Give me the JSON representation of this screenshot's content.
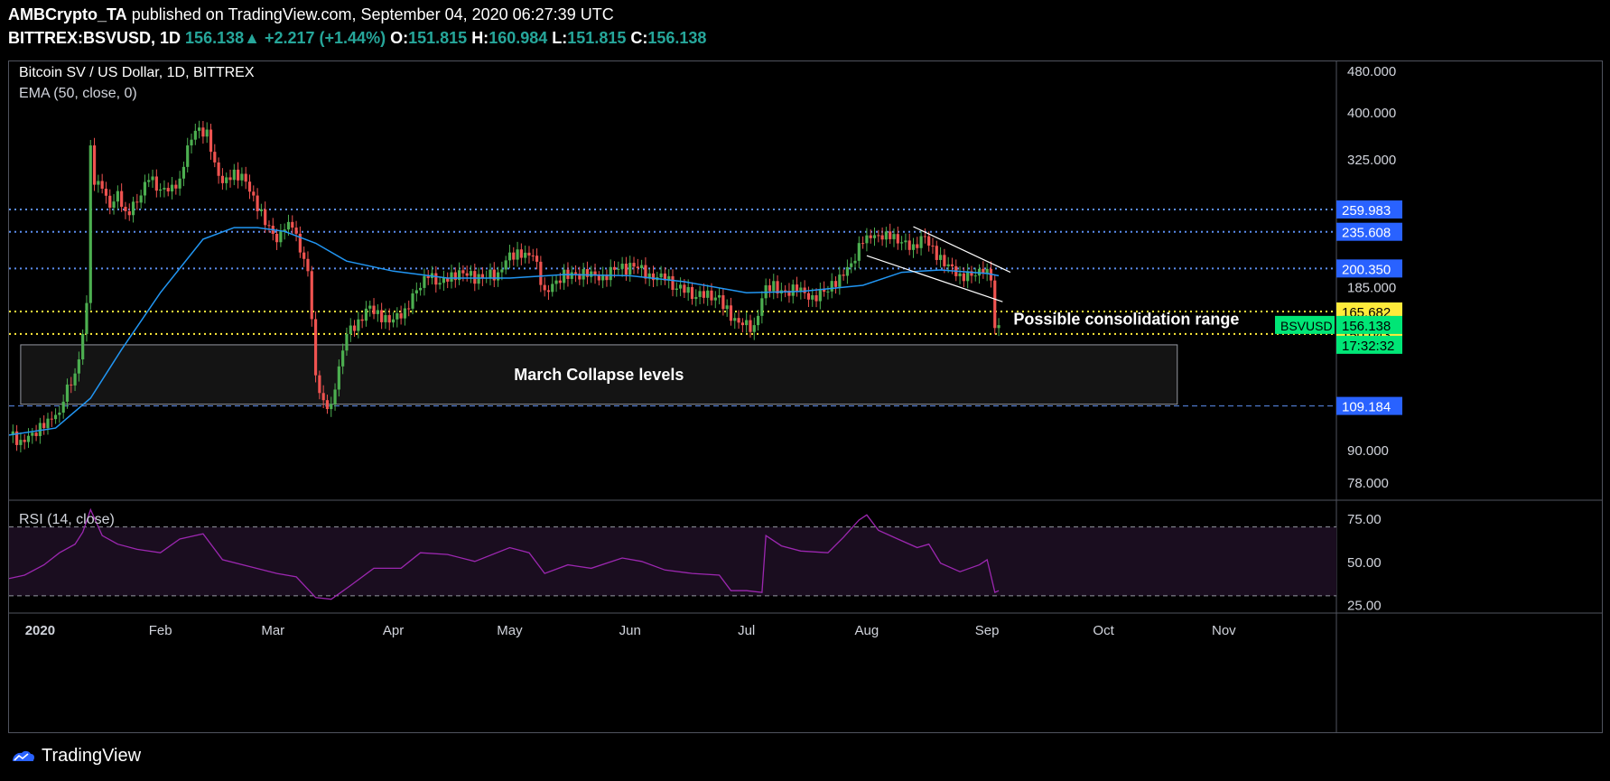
{
  "header": {
    "author": "AMBCrypto_TA",
    "published_text": "published on TradingView.com, September 04, 2020 06:27:39 UTC",
    "symbol": "BITTREX:BSVUSD, 1D",
    "last": "156.138",
    "up_arrow": "▲",
    "change": "+2.217 (+1.44%)",
    "o_label": "O:",
    "o_value": "151.815",
    "h_label": "H:",
    "h_value": "160.984",
    "l_label": "L:",
    "l_value": "151.815",
    "c_label": "C:",
    "c_value": "156.138"
  },
  "footer": {
    "brand": "TradingView",
    "icon": "tradingview-logo-icon"
  },
  "colors": {
    "up": "#26a69a",
    "bull_candle": "#4caf50",
    "bear_candle": "#ef5350",
    "ema": "#2196f3",
    "level_blue": "#5b8def",
    "level_yellow": "#ffeb3b",
    "rsi": "#9c27b0",
    "rsi_band": "#1a0d1f",
    "price_tag": "#00e676"
  },
  "chart_data": [
    {
      "type": "candlestick",
      "title": "Bitcoin SV / US Dollar, 1D, BITTREX",
      "indicator_label": "EMA (50, close, 0)",
      "y_scale": "log",
      "ylim": [
        72,
        500
      ],
      "y_ticks": [
        "480.000",
        "400.000",
        "325.000",
        "235.608",
        "185.000",
        "90.000",
        "78.000"
      ],
      "x_ticks": [
        "2020",
        "Feb",
        "Mar",
        "Apr",
        "May",
        "Jun",
        "Jul",
        "Aug",
        "Sep",
        "Oct",
        "Nov"
      ],
      "x_range": [
        "2019-12-24",
        "2020-11-30"
      ],
      "levels": [
        {
          "label": "259.983",
          "value": 259.983,
          "color": "#5b8def",
          "style": "dotted"
        },
        {
          "label": "235.608",
          "value": 235.608,
          "color": "#5b8def",
          "style": "dotted"
        },
        {
          "label": "200.350",
          "value": 200.35,
          "color": "#5b8def",
          "style": "dotted"
        },
        {
          "label": "165.682",
          "value": 165.682,
          "color": "#ffeb3b",
          "style": "dotted"
        },
        {
          "label": "150.043",
          "value": 150.043,
          "color": "#ffeb3b",
          "style": "dotted"
        },
        {
          "label": "109.184",
          "value": 109.184,
          "color": "#5b8def",
          "style": "dashed"
        }
      ],
      "current_price": {
        "label": "156.138",
        "value": 156.138,
        "countdown": "17:32:32",
        "symbol_tag": "BSVUSD"
      },
      "annotations": [
        {
          "text": "March Collapse levels",
          "x_from": "2019-12-27",
          "x_to": "2020-10-20",
          "y_low": 110,
          "y_high": 143
        },
        {
          "text": "Possible consolidation range",
          "x": "2020-09-05",
          "y": 160
        }
      ],
      "trendlines": [
        {
          "from": [
            "2020-08-13",
            241
          ],
          "to": [
            "2020-09-07",
            197
          ]
        },
        {
          "from": [
            "2020-08-01",
            212
          ],
          "to": [
            "2020-09-05",
            173
          ]
        }
      ],
      "series": [
        {
          "name": "BSVUSD",
          "points": [
            [
              "2019-12-24",
              96
            ],
            [
              "2019-12-27",
              94
            ],
            [
              "2019-12-30",
              97
            ],
            [
              "2020-01-02",
              99
            ],
            [
              "2020-01-04",
              103
            ],
            [
              "2020-01-06",
              106
            ],
            [
              "2020-01-08",
              120
            ],
            [
              "2020-01-10",
              126
            ],
            [
              "2020-01-12",
              150
            ],
            [
              "2020-01-13",
              172
            ],
            [
              "2020-01-14",
              345
            ],
            [
              "2020-01-15",
              290
            ],
            [
              "2020-01-17",
              285
            ],
            [
              "2020-01-19",
              262
            ],
            [
              "2020-01-21",
              282
            ],
            [
              "2020-01-23",
              258
            ],
            [
              "2020-01-26",
              268
            ],
            [
              "2020-01-29",
              296
            ],
            [
              "2020-02-01",
              284
            ],
            [
              "2020-02-04",
              290
            ],
            [
              "2020-02-06",
              298
            ],
            [
              "2020-02-08",
              345
            ],
            [
              "2020-02-10",
              368
            ],
            [
              "2020-02-13",
              370
            ],
            [
              "2020-02-15",
              320
            ],
            [
              "2020-02-17",
              292
            ],
            [
              "2020-02-20",
              310
            ],
            [
              "2020-02-23",
              294
            ],
            [
              "2020-02-26",
              258
            ],
            [
              "2020-02-29",
              242
            ],
            [
              "2020-03-02",
              225
            ],
            [
              "2020-03-04",
              238
            ],
            [
              "2020-03-06",
              240
            ],
            [
              "2020-03-08",
              215
            ],
            [
              "2020-03-10",
              198
            ],
            [
              "2020-03-12",
              125
            ],
            [
              "2020-03-14",
              112
            ],
            [
              "2020-03-16",
              110
            ],
            [
              "2020-03-18",
              130
            ],
            [
              "2020-03-20",
              150
            ],
            [
              "2020-03-23",
              160
            ],
            [
              "2020-03-26",
              170
            ],
            [
              "2020-03-29",
              158
            ],
            [
              "2020-04-01",
              160
            ],
            [
              "2020-04-04",
              168
            ],
            [
              "2020-04-07",
              182
            ],
            [
              "2020-04-10",
              192
            ],
            [
              "2020-04-13",
              188
            ],
            [
              "2020-04-16",
              197
            ],
            [
              "2020-04-20",
              194
            ],
            [
              "2020-04-24",
              192
            ],
            [
              "2020-04-28",
              197
            ],
            [
              "2020-05-01",
              215
            ],
            [
              "2020-05-04",
              210
            ],
            [
              "2020-05-07",
              212
            ],
            [
              "2020-05-10",
              182
            ],
            [
              "2020-05-13",
              190
            ],
            [
              "2020-05-17",
              197
            ],
            [
              "2020-05-21",
              193
            ],
            [
              "2020-05-25",
              195
            ],
            [
              "2020-05-29",
              200
            ],
            [
              "2020-06-02",
              202
            ],
            [
              "2020-06-06",
              196
            ],
            [
              "2020-06-10",
              190
            ],
            [
              "2020-06-15",
              180
            ],
            [
              "2020-06-20",
              176
            ],
            [
              "2020-06-24",
              178
            ],
            [
              "2020-06-27",
              159
            ],
            [
              "2020-06-30",
              156
            ],
            [
              "2020-07-03",
              156
            ],
            [
              "2020-07-06",
              186
            ],
            [
              "2020-07-10",
              182
            ],
            [
              "2020-07-14",
              181
            ],
            [
              "2020-07-18",
              178
            ],
            [
              "2020-07-22",
              181
            ],
            [
              "2020-07-25",
              195
            ],
            [
              "2020-07-28",
              205
            ],
            [
              "2020-07-31",
              224
            ],
            [
              "2020-08-02",
              229
            ],
            [
              "2020-08-04",
              232
            ],
            [
              "2020-08-07",
              228
            ],
            [
              "2020-08-10",
              225
            ],
            [
              "2020-08-13",
              223
            ],
            [
              "2020-08-16",
              231
            ],
            [
              "2020-08-19",
              208
            ],
            [
              "2020-08-22",
              204
            ],
            [
              "2020-08-25",
              196
            ],
            [
              "2020-08-28",
              194
            ],
            [
              "2020-08-31",
              196
            ],
            [
              "2020-09-01",
              200
            ],
            [
              "2020-09-02",
              190
            ],
            [
              "2020-09-03",
              154
            ],
            [
              "2020-09-04",
              156
            ]
          ]
        },
        {
          "name": "EMA (50, close, 0)",
          "points": [
            [
              "2019-12-24",
              96
            ],
            [
              "2020-01-05",
              99
            ],
            [
              "2020-01-14",
              113
            ],
            [
              "2020-01-22",
              140
            ],
            [
              "2020-02-01",
              180
            ],
            [
              "2020-02-12",
              228
            ],
            [
              "2020-02-20",
              240
            ],
            [
              "2020-02-26",
              240
            ],
            [
              "2020-03-04",
              236
            ],
            [
              "2020-03-12",
              224
            ],
            [
              "2020-03-20",
              207
            ],
            [
              "2020-04-01",
              198
            ],
            [
              "2020-04-15",
              192
            ],
            [
              "2020-05-01",
              192
            ],
            [
              "2020-05-15",
              195
            ],
            [
              "2020-06-01",
              194
            ],
            [
              "2020-06-15",
              189
            ],
            [
              "2020-07-01",
              180
            ],
            [
              "2020-07-15",
              181
            ],
            [
              "2020-07-31",
              186
            ],
            [
              "2020-08-10",
              197
            ],
            [
              "2020-08-20",
              199
            ],
            [
              "2020-09-01",
              196
            ],
            [
              "2020-09-04",
              194
            ]
          ]
        }
      ]
    },
    {
      "type": "line",
      "title": "RSI (14, close)",
      "ylim": [
        20,
        85
      ],
      "y_ticks": [
        "75.00",
        "50.00",
        "25.00"
      ],
      "bands": [
        30,
        70
      ],
      "series": [
        {
          "name": "RSI",
          "points": [
            [
              "2019-12-24",
              40
            ],
            [
              "2019-12-28",
              42
            ],
            [
              "2020-01-02",
              48
            ],
            [
              "2020-01-06",
              55
            ],
            [
              "2020-01-10",
              60
            ],
            [
              "2020-01-12",
              67
            ],
            [
              "2020-01-14",
              80
            ],
            [
              "2020-01-17",
              65
            ],
            [
              "2020-01-21",
              60
            ],
            [
              "2020-01-26",
              57
            ],
            [
              "2020-02-01",
              55
            ],
            [
              "2020-02-06",
              63
            ],
            [
              "2020-02-12",
              66
            ],
            [
              "2020-02-17",
              51
            ],
            [
              "2020-02-24",
              47
            ],
            [
              "2020-03-02",
              43
            ],
            [
              "2020-03-07",
              41
            ],
            [
              "2020-03-12",
              29
            ],
            [
              "2020-03-16",
              28
            ],
            [
              "2020-03-21",
              36
            ],
            [
              "2020-03-27",
              46
            ],
            [
              "2020-04-03",
              46
            ],
            [
              "2020-04-08",
              55
            ],
            [
              "2020-04-15",
              54
            ],
            [
              "2020-04-22",
              50
            ],
            [
              "2020-05-01",
              58
            ],
            [
              "2020-05-06",
              55
            ],
            [
              "2020-05-10",
              43
            ],
            [
              "2020-05-16",
              48
            ],
            [
              "2020-05-22",
              46
            ],
            [
              "2020-05-30",
              52
            ],
            [
              "2020-06-04",
              50
            ],
            [
              "2020-06-10",
              45
            ],
            [
              "2020-06-17",
              43
            ],
            [
              "2020-06-24",
              42
            ],
            [
              "2020-06-27",
              33
            ],
            [
              "2020-07-01",
              33
            ],
            [
              "2020-07-05",
              32
            ],
            [
              "2020-07-06",
              65
            ],
            [
              "2020-07-10",
              59
            ],
            [
              "2020-07-15",
              56
            ],
            [
              "2020-07-22",
              55
            ],
            [
              "2020-07-26",
              64
            ],
            [
              "2020-07-30",
              74
            ],
            [
              "2020-08-01",
              77
            ],
            [
              "2020-08-04",
              68
            ],
            [
              "2020-08-09",
              63
            ],
            [
              "2020-08-14",
              58
            ],
            [
              "2020-08-17",
              60
            ],
            [
              "2020-08-20",
              49
            ],
            [
              "2020-08-25",
              44
            ],
            [
              "2020-08-30",
              48
            ],
            [
              "2020-09-01",
              51
            ],
            [
              "2020-09-03",
              32
            ],
            [
              "2020-09-04",
              33
            ]
          ]
        }
      ]
    }
  ]
}
